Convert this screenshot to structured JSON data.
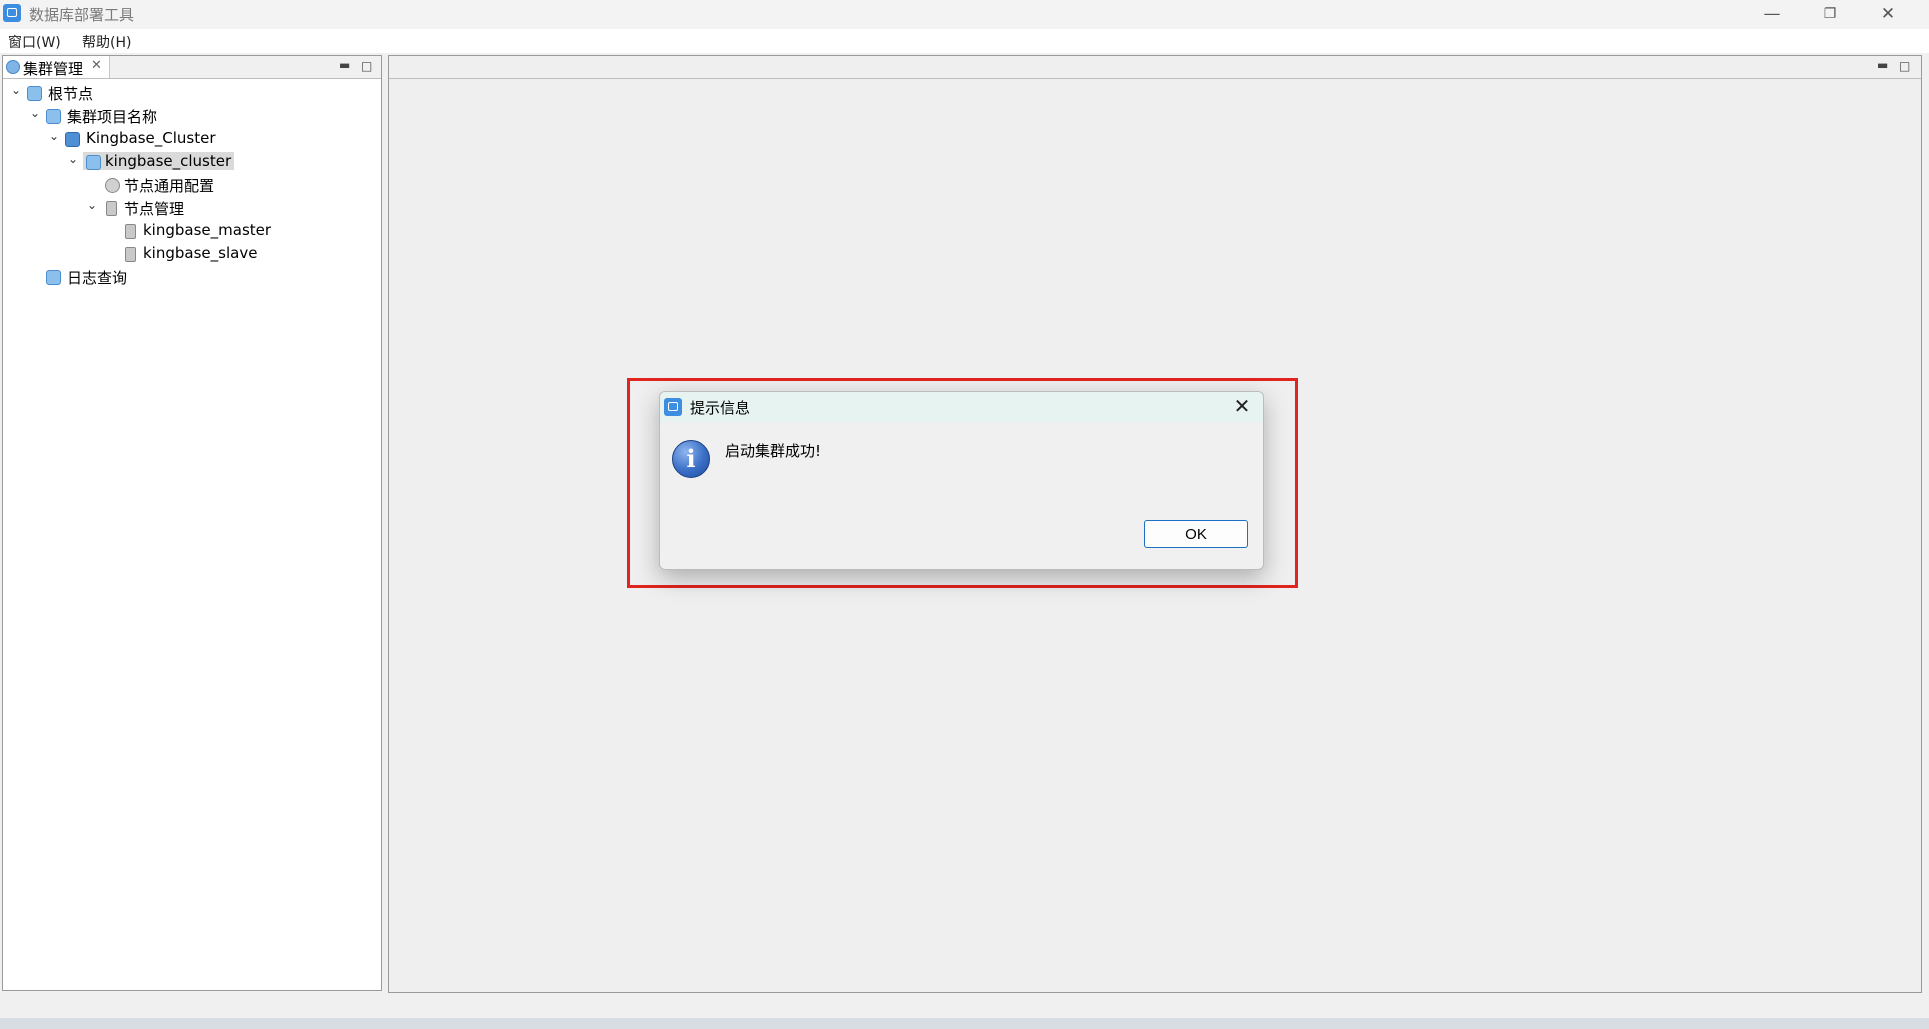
{
  "window": {
    "title": "数据库部署工具",
    "minimize": "—",
    "restore": "❐",
    "close": "✕"
  },
  "menu": [
    {
      "label": "窗口(W)"
    },
    {
      "label": "帮助(H)"
    }
  ],
  "left_panel": {
    "tab_label": "集群管理",
    "tab_close": "✕",
    "minimize": "▬",
    "maximize": "□",
    "tree": [
      {
        "label": "根节点",
        "icon": "cluster-folder-icon",
        "expanded": true
      },
      {
        "label": "集群项目名称",
        "icon": "cluster-folder-icon",
        "expanded": true
      },
      {
        "label": "Kingbase_Cluster",
        "icon": "cluster-icon",
        "expanded": true
      },
      {
        "label": "kingbase_cluster",
        "icon": "cluster-folder-icon",
        "expanded": true,
        "selected": true
      },
      {
        "label": "节点通用配置",
        "icon": "gear-icon"
      },
      {
        "label": "节点管理",
        "icon": "db-icon",
        "expanded": true
      },
      {
        "label": "kingbase_master",
        "icon": "db-icon"
      },
      {
        "label": "kingbase_slave",
        "icon": "db-icon"
      },
      {
        "label": "日志查询",
        "icon": "cluster-folder-icon"
      }
    ]
  },
  "right_panel": {
    "minimize": "▬",
    "maximize": "□"
  },
  "dialog": {
    "title": "提示信息",
    "close": "✕",
    "icon": "info-icon",
    "icon_glyph": "i",
    "message": "启动集群成功!",
    "ok_label": "OK"
  },
  "colors": {
    "highlight": "#e0241e",
    "accent": "#1d6fc2",
    "dialog_title_bg": "#e7f3f0"
  }
}
